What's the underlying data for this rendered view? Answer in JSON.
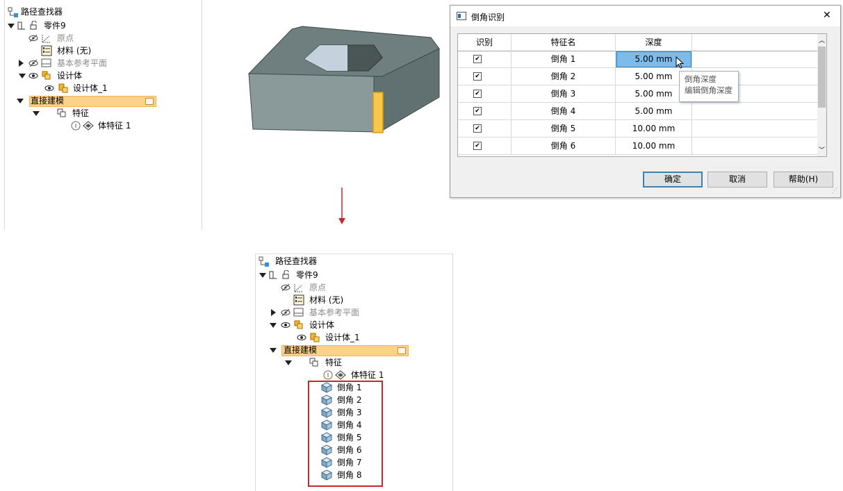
{
  "browser": {
    "title": "路径查找器",
    "part": "零件9",
    "origin": "原点",
    "material": "材料 (无)",
    "ref_planes": "基本参考平面",
    "design_body": "设计体",
    "design_body_1": "设计体_1",
    "direct_modeling": "直接建模",
    "features": "特征",
    "body_feature": "体特征 1"
  },
  "result_features": [
    "倒角 1",
    "倒角 2",
    "倒角 3",
    "倒角 4",
    "倒角 5",
    "倒角 6",
    "倒角 7",
    "倒角 8"
  ],
  "dialog": {
    "title": "倒角识别",
    "columns": [
      "识别",
      "特征名",
      "深度"
    ],
    "rows": [
      {
        "name": "倒角 1",
        "depth": "5.00 mm",
        "checked": true
      },
      {
        "name": "倒角 2",
        "depth": "5.00 mm",
        "checked": true
      },
      {
        "name": "倒角 3",
        "depth": "5.00 mm",
        "checked": true
      },
      {
        "name": "倒角 4",
        "depth": "5.00 mm",
        "checked": true
      },
      {
        "name": "倒角 5",
        "depth": "10.00 mm",
        "checked": true
      },
      {
        "name": "倒角 6",
        "depth": "10.00 mm",
        "checked": true
      }
    ],
    "tooltip_line1": "倒角深度",
    "tooltip_line2": "编辑倒角深度",
    "ok": "确定",
    "cancel": "取消",
    "help": "帮助(H)",
    "close_glyph": "✕",
    "check_glyph": "✔"
  },
  "colors": {
    "highlight": "#fbd18c",
    "selected_cell": "#7bbcec",
    "arrow": "#c8282a",
    "model_top": "#6f7e7e",
    "model_side": "#859595",
    "model_edge": "#f8c84a"
  }
}
